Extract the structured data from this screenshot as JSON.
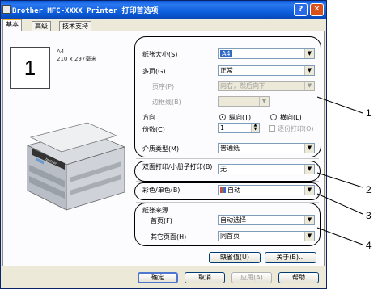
{
  "window": {
    "title": "Brother MFC-XXXX Printer 打印首选项",
    "help_btn": "?",
    "close_btn": "✕"
  },
  "tabs": [
    "基本",
    "高级",
    "技术支持"
  ],
  "preview": {
    "pages": "1",
    "paper_size_line1": "A4",
    "paper_size_line2": "210 x 297毫米"
  },
  "settings": {
    "paper_size": {
      "label": "纸张大小(S)",
      "value": "A4"
    },
    "multiple_page": {
      "label": "多页(G)",
      "value": "正常"
    },
    "page_order": {
      "label": "页序(P)",
      "value": "向右，然后向下"
    },
    "border_line": {
      "label": "边框线(B)",
      "value": ""
    },
    "orientation": {
      "label": "方向",
      "portrait": "纵向(T)",
      "landscape": "横向(L)",
      "selected": "portrait"
    },
    "copies": {
      "label": "份数(C)",
      "value": "1",
      "collate": "逐份打印(O)"
    },
    "media_type": {
      "label": "介质类型(M)",
      "value": "普通纸"
    },
    "duplex": {
      "label": "双面打印/小册子打印(B)",
      "value": "无"
    },
    "color_mono": {
      "label": "彩色/单色(B)",
      "value": "自动"
    },
    "paper_source": {
      "label": "纸张来源",
      "first_page": {
        "label": "首页(F)",
        "value": "自动选择"
      },
      "other_pages": {
        "label": "其它页面(H)",
        "value": "同首页"
      }
    }
  },
  "buttons": {
    "default": "缺省值(U)",
    "about": "关于(B)...",
    "ok": "确定",
    "cancel": "取消",
    "apply": "应用(A)",
    "help": "帮助"
  },
  "callouts": [
    "1",
    "2",
    "3",
    "4"
  ],
  "icons": [
    "printer-app-icon",
    "help-icon",
    "close-icon",
    "dropdown-arrow-icon",
    "color-mode-icon"
  ],
  "colors": {
    "title_bar": "#0a58d8",
    "selected": "#316ac5",
    "tab_highlight": "#f0b030"
  }
}
